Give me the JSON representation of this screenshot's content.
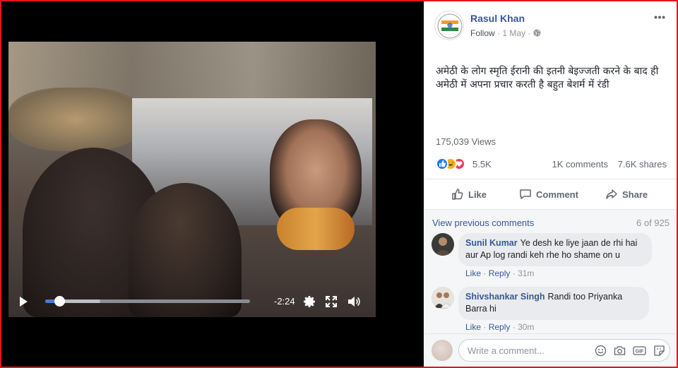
{
  "video": {
    "progress": 0.07,
    "buffered": 0.27,
    "time_remaining": "-2:24"
  },
  "post": {
    "author": "Rasul Khan",
    "follow_label": "Follow",
    "separator": "·",
    "date": "1 May",
    "separator2": "·",
    "text": "अमेठी के लोग स्मृति ईरानी की इतनी बेइज्जती करने के बाद ही अमेठी में अपना प्रचार करती है बहुत बेशर्म में रंडी",
    "views": "175,039 Views",
    "reactions_count": "5.5K",
    "comments_count": "1K comments",
    "shares_count": "7.6K shares"
  },
  "actions": {
    "like": "Like",
    "comment": "Comment",
    "share": "Share"
  },
  "comments_section": {
    "view_previous": "View previous comments",
    "count": "6 of 925",
    "items": [
      {
        "name": "Sunil Kumar",
        "text_line1": "Ye desh ke liye jaan de rhi hai",
        "text_line2": "aur Ap log randi keh rhe ho shame on u",
        "like": "Like",
        "reply": "Reply",
        "time": "31m"
      },
      {
        "name": "Shivshankar Singh",
        "text_line1": "Randi too Priyanka",
        "text_line2": "Barra hi",
        "like": "Like",
        "reply": "Reply",
        "time": "30m"
      }
    ],
    "write_placeholder": "Write a comment...",
    "gif_label": "GIF"
  },
  "colors": {
    "frame": "#e4151c",
    "link": "#385898",
    "progress": "#4a78d6"
  }
}
